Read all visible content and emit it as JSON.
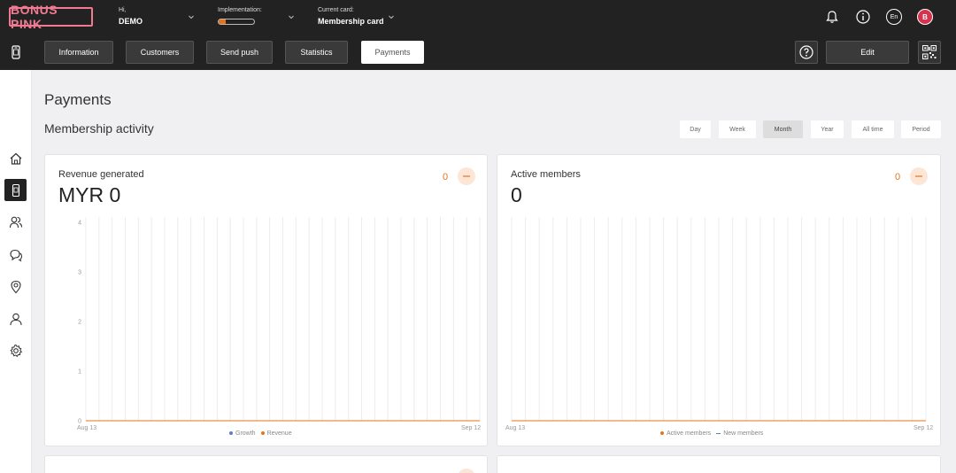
{
  "topbar": {
    "logo": "BONUS PINK",
    "greeting_small": "Hi,",
    "greeting_name": "DEMO",
    "implementation_label": "Implementation:",
    "implementation_progress": 0.2,
    "card_label": "Current card:",
    "card_name": "Membership card",
    "language": "En",
    "avatar_letter": "B"
  },
  "nav": {
    "tabs": [
      {
        "label": "Information"
      },
      {
        "label": "Customers"
      },
      {
        "label": "Send push"
      },
      {
        "label": "Statistics"
      },
      {
        "label": "Payments"
      }
    ],
    "edit_label": "Edit"
  },
  "main": {
    "page_title": "Payments",
    "section_title": "Membership activity",
    "periods": [
      "Day",
      "Week",
      "Month",
      "Year",
      "All time",
      "Period"
    ],
    "active_period": "Month"
  },
  "cards": [
    {
      "title": "Revenue generated",
      "value": "MYR 0",
      "count": "0",
      "y_ticks": [
        "4",
        "3",
        "2",
        "1",
        "0"
      ],
      "x_start": "Aug 13",
      "x_end": "Sep 12",
      "legend": [
        "Growth",
        "Revenue"
      ]
    },
    {
      "title": "Active members",
      "value": "0",
      "count": "0",
      "x_start": "Aug 13",
      "x_end": "Sep 12",
      "legend": [
        "Active members",
        "New members"
      ]
    }
  ],
  "colors": {
    "accent": "#e8741a",
    "brand_pink": "#f07a92",
    "dark": "#222222",
    "series_blue": "#5b7bd6"
  },
  "icons": {
    "sidebar": [
      "home-icon",
      "phone-card-icon",
      "customers-icon",
      "chat-icon",
      "location-icon",
      "user-icon",
      "settings-icon"
    ],
    "topbar": [
      "bell-icon",
      "info-icon",
      "language-icon",
      "avatar-icon"
    ]
  },
  "chart_data": [
    {
      "type": "line",
      "title": "Revenue generated",
      "x_range": [
        "Aug 13",
        "Sep 12"
      ],
      "ylim": [
        0,
        4
      ],
      "series": [
        {
          "name": "Growth",
          "values": [
            0
          ]
        },
        {
          "name": "Revenue",
          "values": [
            0
          ]
        }
      ]
    },
    {
      "type": "line",
      "title": "Active members",
      "x_range": [
        "Aug 13",
        "Sep 12"
      ],
      "series": [
        {
          "name": "Active members",
          "values": [
            0
          ]
        },
        {
          "name": "New members",
          "values": [
            0
          ]
        }
      ]
    }
  ]
}
